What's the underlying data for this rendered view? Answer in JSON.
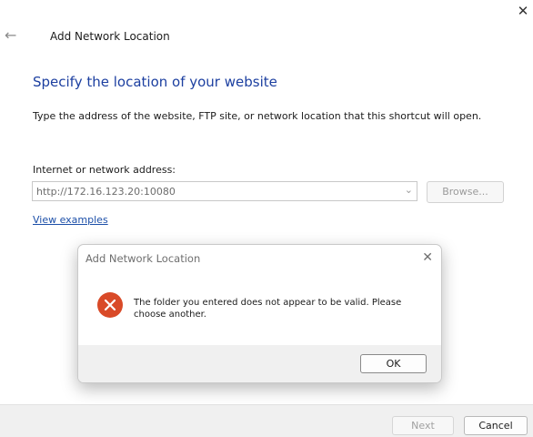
{
  "window": {
    "title": "Add Network Location",
    "close_glyph": "✕",
    "back_glyph": "←",
    "back_icon": "back-arrow-icon",
    "close_icon": "close-icon"
  },
  "main": {
    "heading": "Specify the location of your website",
    "description": "Type the address of the website, FTP site, or network location that this shortcut will open.",
    "address_label": "Internet or network address:",
    "address_value": "http://172.16.123.20:10080",
    "chevron_glyph": "⌄",
    "browse_label": "Browse...",
    "view_examples_label": "View examples"
  },
  "footer": {
    "next_label": "Next",
    "cancel_label": "Cancel"
  },
  "dialog": {
    "title": "Add Network Location",
    "close_glyph": "✕",
    "message": "The folder you entered does not appear to be valid.  Please choose another.",
    "ok_label": "OK",
    "icon": "error-icon"
  },
  "colors": {
    "heading": "#1c3fa0",
    "link": "#1c4fa8",
    "error_icon": "#d94a28",
    "footer_bg": "#f0f0f0"
  }
}
